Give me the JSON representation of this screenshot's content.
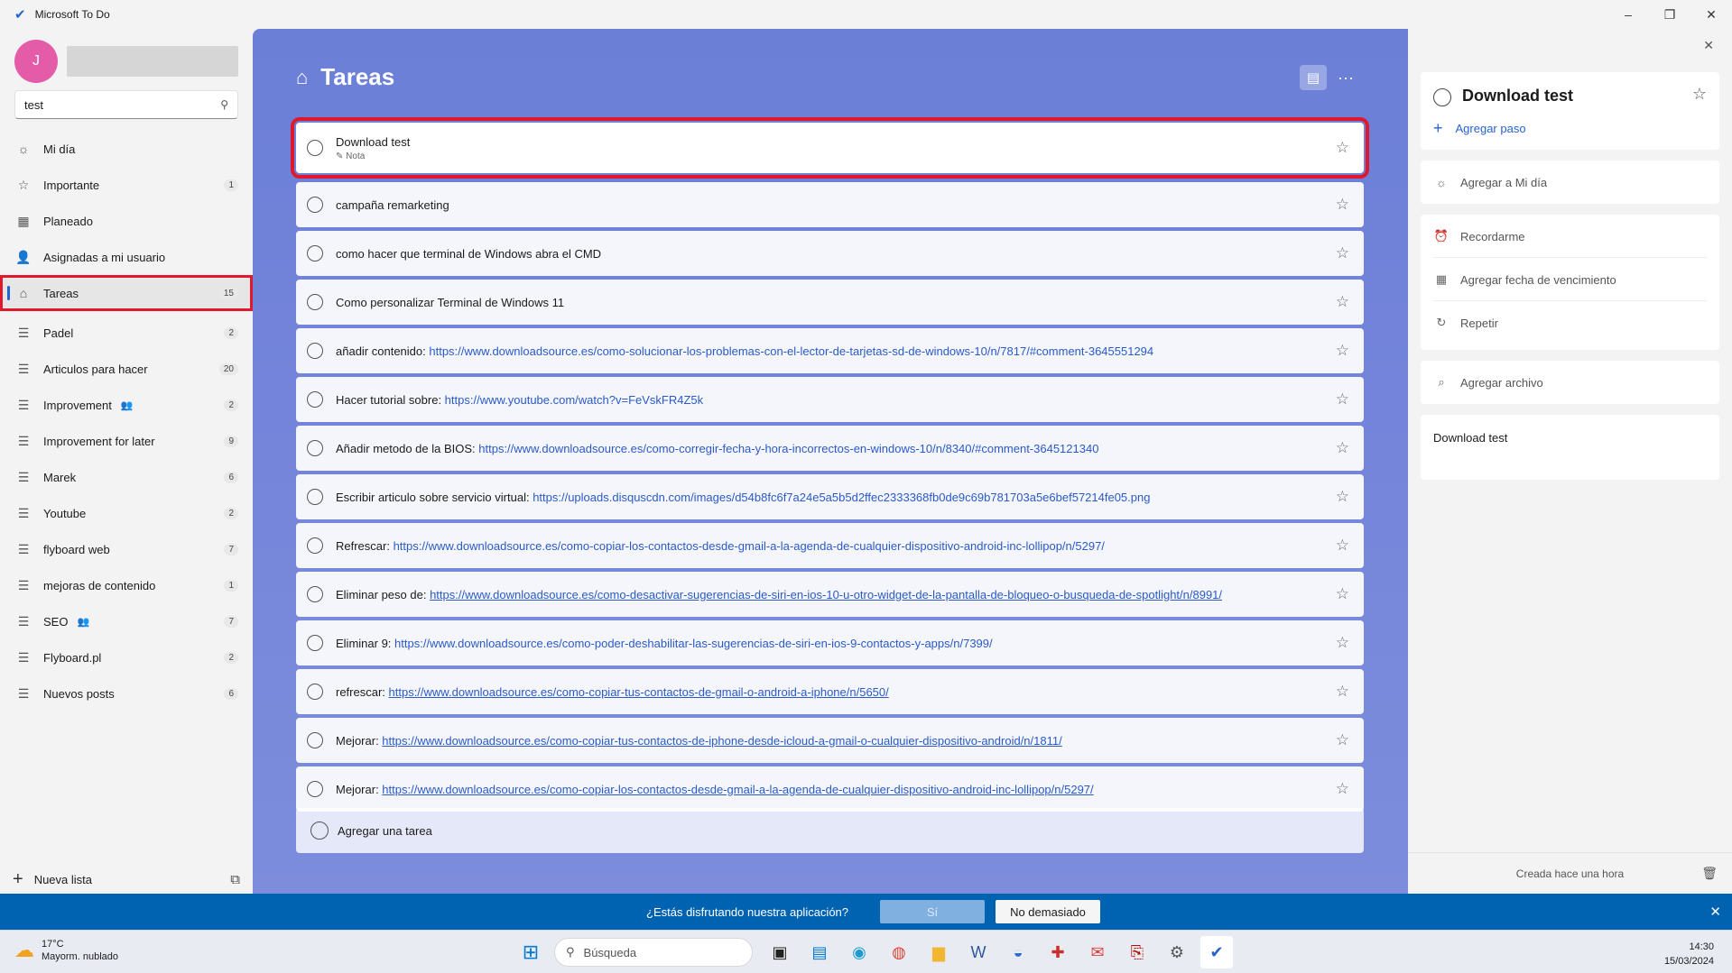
{
  "window": {
    "title": "Microsoft To Do",
    "controls": [
      "–",
      "❐",
      "✕"
    ]
  },
  "sidebar": {
    "avatar_initial": "J",
    "search_value": "test",
    "items": [
      {
        "name": "mi-dia",
        "icon": "sun-icon",
        "glyph": "☼",
        "label": "Mi día",
        "count": ""
      },
      {
        "name": "importante",
        "icon": "star-icon",
        "glyph": "☆",
        "label": "Importante",
        "count": "1"
      },
      {
        "name": "planeado",
        "icon": "calendar-icon",
        "glyph": "▦",
        "label": "Planeado",
        "count": ""
      },
      {
        "name": "asignadas",
        "icon": "person-icon",
        "glyph": "👤",
        "label": "Asignadas a mi usuario",
        "count": ""
      },
      {
        "name": "tareas",
        "icon": "home-icon",
        "glyph": "⌂",
        "label": "Tareas",
        "count": "15"
      }
    ],
    "lists": [
      {
        "label": "Padel",
        "count": "2",
        "shared": false
      },
      {
        "label": "Articulos para hacer",
        "count": "20",
        "shared": false
      },
      {
        "label": "Improvement",
        "count": "2",
        "shared": true
      },
      {
        "label": "Improvement for later",
        "count": "9",
        "shared": false
      },
      {
        "label": "Marek",
        "count": "6",
        "shared": false
      },
      {
        "label": "Youtube",
        "count": "2",
        "shared": false
      },
      {
        "label": "flyboard web",
        "count": "7",
        "shared": false
      },
      {
        "label": "mejoras de contenido",
        "count": "1",
        "shared": false
      },
      {
        "label": "SEO",
        "count": "7",
        "shared": true
      },
      {
        "label": "Flyboard.pl",
        "count": "2",
        "shared": false
      },
      {
        "label": "Nuevos posts",
        "count": "6",
        "shared": false
      }
    ],
    "new_list_label": "Nueva lista"
  },
  "main": {
    "title": "Tareas",
    "tasks": [
      {
        "prefix": "Download test",
        "link": "",
        "underline": false,
        "note": "Nota"
      },
      {
        "prefix": "campaña remarketing",
        "link": "",
        "underline": false,
        "note": ""
      },
      {
        "prefix": "como hacer que terminal de Windows abra el CMD",
        "link": "",
        "underline": false,
        "note": ""
      },
      {
        "prefix": "Como personalizar Terminal de Windows 11",
        "link": "",
        "underline": false,
        "note": ""
      },
      {
        "prefix": "añadir contenido: ",
        "link": "https://www.downloadsource.es/como-solucionar-los-problemas-con-el-lector-de-tarjetas-sd-de-windows-10/n/7817/#comment-3645551294",
        "underline": false,
        "note": ""
      },
      {
        "prefix": "Hacer tutorial sobre: ",
        "link": "https://www.youtube.com/watch?v=FeVskFR4Z5k",
        "underline": false,
        "note": ""
      },
      {
        "prefix": "Añadir metodo de la BIOS: ",
        "link": "https://www.downloadsource.es/como-corregir-fecha-y-hora-incorrectos-en-windows-10/n/8340/#comment-3645121340",
        "underline": false,
        "note": ""
      },
      {
        "prefix": "Escribir articulo sobre servicio virtual: ",
        "link": "https://uploads.disquscdn.com/images/d54b8fc6f7a24e5a5b5d2ffec2333368fb0de9c69b781703a5e6bef57214fe05.png",
        "underline": false,
        "note": ""
      },
      {
        "prefix": "Refrescar: ",
        "link": "https://www.downloadsource.es/como-copiar-los-contactos-desde-gmail-a-la-agenda-de-cualquier-dispositivo-android-inc-lollipop/n/5297/",
        "underline": false,
        "note": ""
      },
      {
        "prefix": "Eliminar peso de: ",
        "link": "https://www.downloadsource.es/como-desactivar-sugerencias-de-siri-en-ios-10-u-otro-widget-de-la-pantalla-de-bloqueo-o-busqueda-de-spotlight/n/8991/",
        "underline": true,
        "note": ""
      },
      {
        "prefix": "Eliminar 9: ",
        "link": "https://www.downloadsource.es/como-poder-deshabilitar-las-sugerencias-de-siri-en-ios-9-contactos-y-apps/n/7399/",
        "underline": false,
        "note": ""
      },
      {
        "prefix": "refrescar: ",
        "link": "https://www.downloadsource.es/como-copiar-tus-contactos-de-gmail-o-android-a-iphone/n/5650/",
        "underline": true,
        "note": ""
      },
      {
        "prefix": "Mejorar: ",
        "link": "https://www.downloadsource.es/como-copiar-tus-contactos-de-iphone-desde-icloud-a-gmail-o-cualquier-dispositivo-android/n/1811/",
        "underline": true,
        "note": ""
      },
      {
        "prefix": "Mejorar: ",
        "link": "https://www.downloadsource.es/como-copiar-los-contactos-desde-gmail-a-la-agenda-de-cualquier-dispositivo-android-inc-lollipop/n/5297/",
        "underline": true,
        "note": ""
      }
    ],
    "add_task_label": "Agregar una tarea"
  },
  "detail": {
    "title": "Download test",
    "add_step": "Agregar paso",
    "add_my_day": "Agregar a Mi día",
    "remind_me": "Recordarme",
    "add_due_date": "Agregar fecha de vencimiento",
    "repeat": "Repetir",
    "add_file": "Agregar archivo",
    "note": "Download test",
    "created": "Creada hace una hora"
  },
  "feedback": {
    "question": "¿Estás disfrutando nuestra aplicación?",
    "yes": "Sí",
    "no": "No demasiado"
  },
  "taskbar": {
    "temperature": "17°C",
    "weather": "Mayorm. nublado",
    "search_placeholder": "Búsqueda",
    "time": "14:30",
    "date": "15/03/2024"
  }
}
